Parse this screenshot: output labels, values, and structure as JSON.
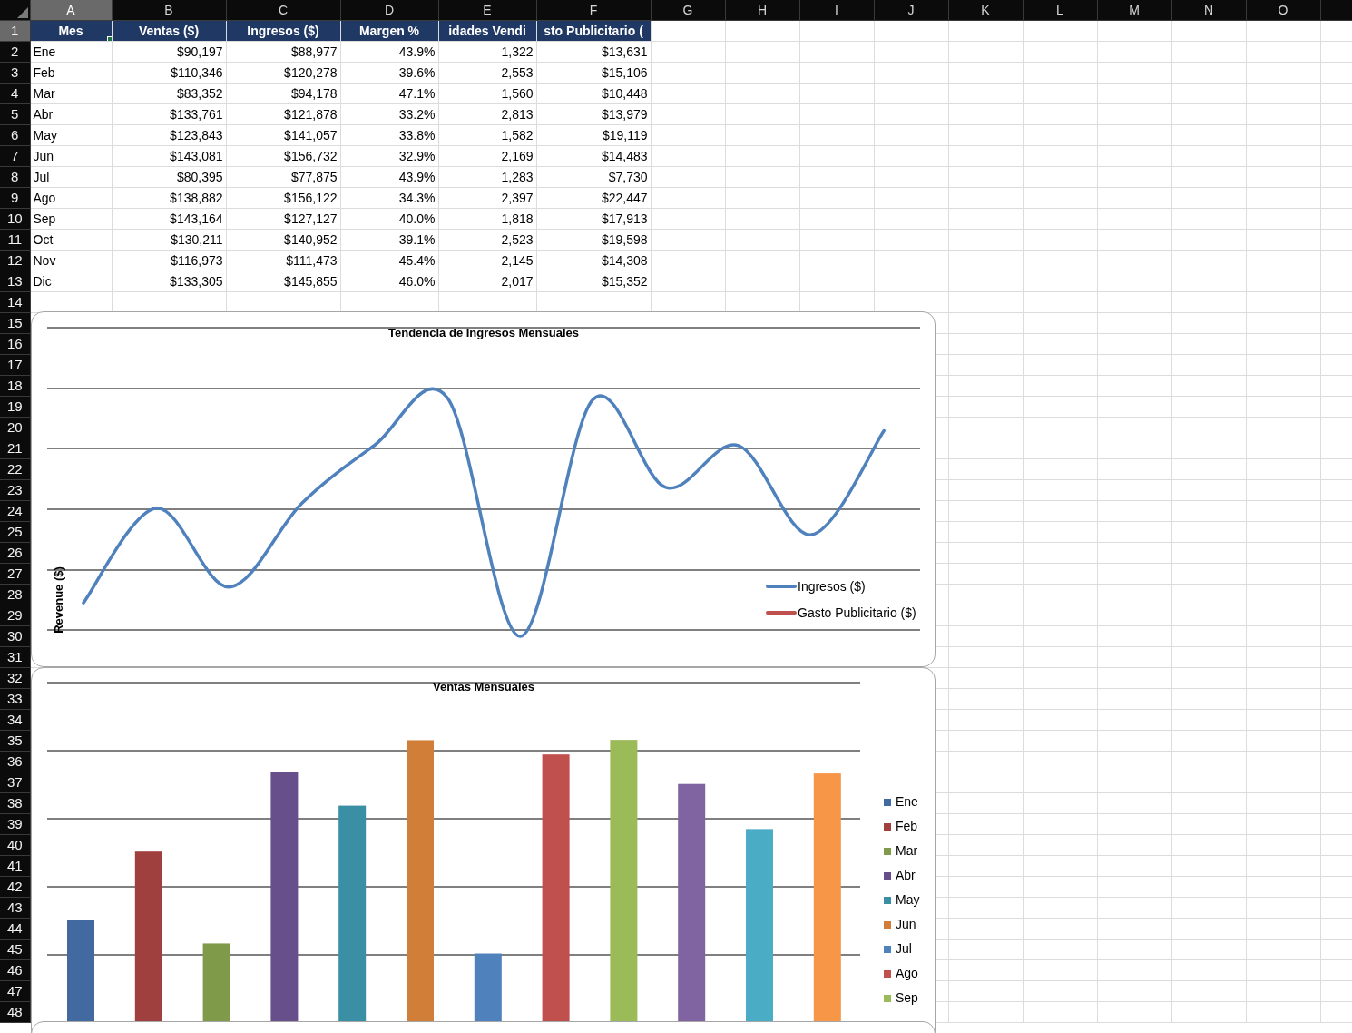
{
  "columns": [
    {
      "letter": "A",
      "selected": true
    },
    {
      "letter": "B",
      "selected": false
    },
    {
      "letter": "C",
      "selected": false
    },
    {
      "letter": "D",
      "selected": false
    },
    {
      "letter": "E",
      "selected": false
    },
    {
      "letter": "F",
      "selected": false
    },
    {
      "letter": "G",
      "selected": false
    },
    {
      "letter": "H",
      "selected": false
    },
    {
      "letter": "I",
      "selected": false
    },
    {
      "letter": "J",
      "selected": false
    },
    {
      "letter": "K",
      "selected": false
    },
    {
      "letter": "L",
      "selected": false
    },
    {
      "letter": "M",
      "selected": false
    },
    {
      "letter": "N",
      "selected": false
    },
    {
      "letter": "O",
      "selected": false
    }
  ],
  "row_headers": [
    {
      "label": "1",
      "selected": true
    },
    {
      "label": "2",
      "selected": false
    },
    {
      "label": "3",
      "selected": false
    },
    {
      "label": "4",
      "selected": false
    },
    {
      "label": "5",
      "selected": false
    },
    {
      "label": "6",
      "selected": false
    },
    {
      "label": "7",
      "selected": false
    },
    {
      "label": "8",
      "selected": false
    },
    {
      "label": "9",
      "selected": false
    },
    {
      "label": "10",
      "selected": false
    },
    {
      "label": "11",
      "selected": false
    },
    {
      "label": "12",
      "selected": false
    },
    {
      "label": "13",
      "selected": false
    },
    {
      "label": "14",
      "selected": false
    },
    {
      "label": "15",
      "selected": false
    },
    {
      "label": "16",
      "selected": false
    },
    {
      "label": "17",
      "selected": false
    },
    {
      "label": "18",
      "selected": false
    },
    {
      "label": "19",
      "selected": false
    },
    {
      "label": "20",
      "selected": false
    },
    {
      "label": "21",
      "selected": false
    },
    {
      "label": "22",
      "selected": false
    },
    {
      "label": "23",
      "selected": false
    },
    {
      "label": "24",
      "selected": false
    },
    {
      "label": "25",
      "selected": false
    },
    {
      "label": "26",
      "selected": false
    },
    {
      "label": "27",
      "selected": false
    },
    {
      "label": "28",
      "selected": false
    },
    {
      "label": "29",
      "selected": false
    },
    {
      "label": "30",
      "selected": false
    },
    {
      "label": "31",
      "selected": false
    },
    {
      "label": "32",
      "selected": false
    },
    {
      "label": "33",
      "selected": false
    },
    {
      "label": "34",
      "selected": false
    },
    {
      "label": "35",
      "selected": false
    },
    {
      "label": "36",
      "selected": false
    },
    {
      "label": "37",
      "selected": false
    },
    {
      "label": "38",
      "selected": false
    },
    {
      "label": "39",
      "selected": false
    },
    {
      "label": "40",
      "selected": false
    },
    {
      "label": "41",
      "selected": false
    },
    {
      "label": "42",
      "selected": false
    },
    {
      "label": "43",
      "selected": false
    },
    {
      "label": "44",
      "selected": false
    },
    {
      "label": "45",
      "selected": false
    },
    {
      "label": "46",
      "selected": false
    },
    {
      "label": "47",
      "selected": false
    },
    {
      "label": "48",
      "selected": false
    }
  ],
  "header": [
    "Mes",
    "Ventas ($)",
    "Ingresos ($)",
    "Margen %",
    "idades Vendi",
    "sto Publicitario ("
  ],
  "data_rows": [
    [
      "Ene",
      "$90,197",
      "$88,977",
      "43.9%",
      "1,322",
      "$13,631"
    ],
    [
      "Feb",
      "$110,346",
      "$120,278",
      "39.6%",
      "2,553",
      "$15,106"
    ],
    [
      "Mar",
      "$83,352",
      "$94,178",
      "47.1%",
      "1,560",
      "$10,448"
    ],
    [
      "Abr",
      "$133,761",
      "$121,878",
      "33.2%",
      "2,813",
      "$13,979"
    ],
    [
      "May",
      "$123,843",
      "$141,057",
      "33.8%",
      "1,582",
      "$19,119"
    ],
    [
      "Jun",
      "$143,081",
      "$156,732",
      "32.9%",
      "2,169",
      "$14,483"
    ],
    [
      "Jul",
      "$80,395",
      "$77,875",
      "43.9%",
      "1,283",
      "$7,730"
    ],
    [
      "Ago",
      "$138,882",
      "$156,122",
      "34.3%",
      "2,397",
      "$22,447"
    ],
    [
      "Sep",
      "$143,164",
      "$127,127",
      "40.0%",
      "1,818",
      "$17,913"
    ],
    [
      "Oct",
      "$130,211",
      "$140,952",
      "39.1%",
      "2,523",
      "$19,598"
    ],
    [
      "Nov",
      "$116,973",
      "$111,473",
      "45.4%",
      "2,145",
      "$14,308"
    ],
    [
      "Dic",
      "$133,305",
      "$145,855",
      "46.0%",
      "2,017",
      "$15,352"
    ]
  ],
  "charts": [
    {
      "kind": "line",
      "title": "Tendencia de Ingresos Mensuales",
      "ylabel": "Revenue ($)",
      "legend": [
        {
          "label": "Ingresos ($)",
          "color": "#4f81bd"
        },
        {
          "label": "Gasto Publicitario ($)",
          "color": "#c0504d"
        }
      ]
    },
    {
      "kind": "bar",
      "title": "Ventas Mensuales",
      "bars": [
        {
          "color": "#4269a0"
        },
        {
          "color": "#a0403e"
        },
        {
          "color": "#7f9a48"
        },
        {
          "color": "#664f8a"
        },
        {
          "color": "#3a8fa4"
        },
        {
          "color": "#d07e38"
        },
        {
          "color": "#4f81bd"
        },
        {
          "color": "#c0504d"
        },
        {
          "color": "#9bbb59"
        },
        {
          "color": "#8064a2"
        },
        {
          "color": "#4bacc6"
        },
        {
          "color": "#f79646"
        }
      ],
      "legend": [
        {
          "label": "Ene",
          "color": "#4269a0"
        },
        {
          "label": "Feb",
          "color": "#a0403e"
        },
        {
          "label": "Mar",
          "color": "#7f9a48"
        },
        {
          "label": "Abr",
          "color": "#664f8a"
        },
        {
          "label": "May",
          "color": "#3a8fa4"
        },
        {
          "label": "Jun",
          "color": "#d07e38"
        },
        {
          "label": "Jul",
          "color": "#4f81bd"
        },
        {
          "label": "Ago",
          "color": "#c0504d"
        },
        {
          "label": "Sep",
          "color": "#9bbb59"
        }
      ]
    },
    {
      "kind": "panel"
    }
  ]
}
